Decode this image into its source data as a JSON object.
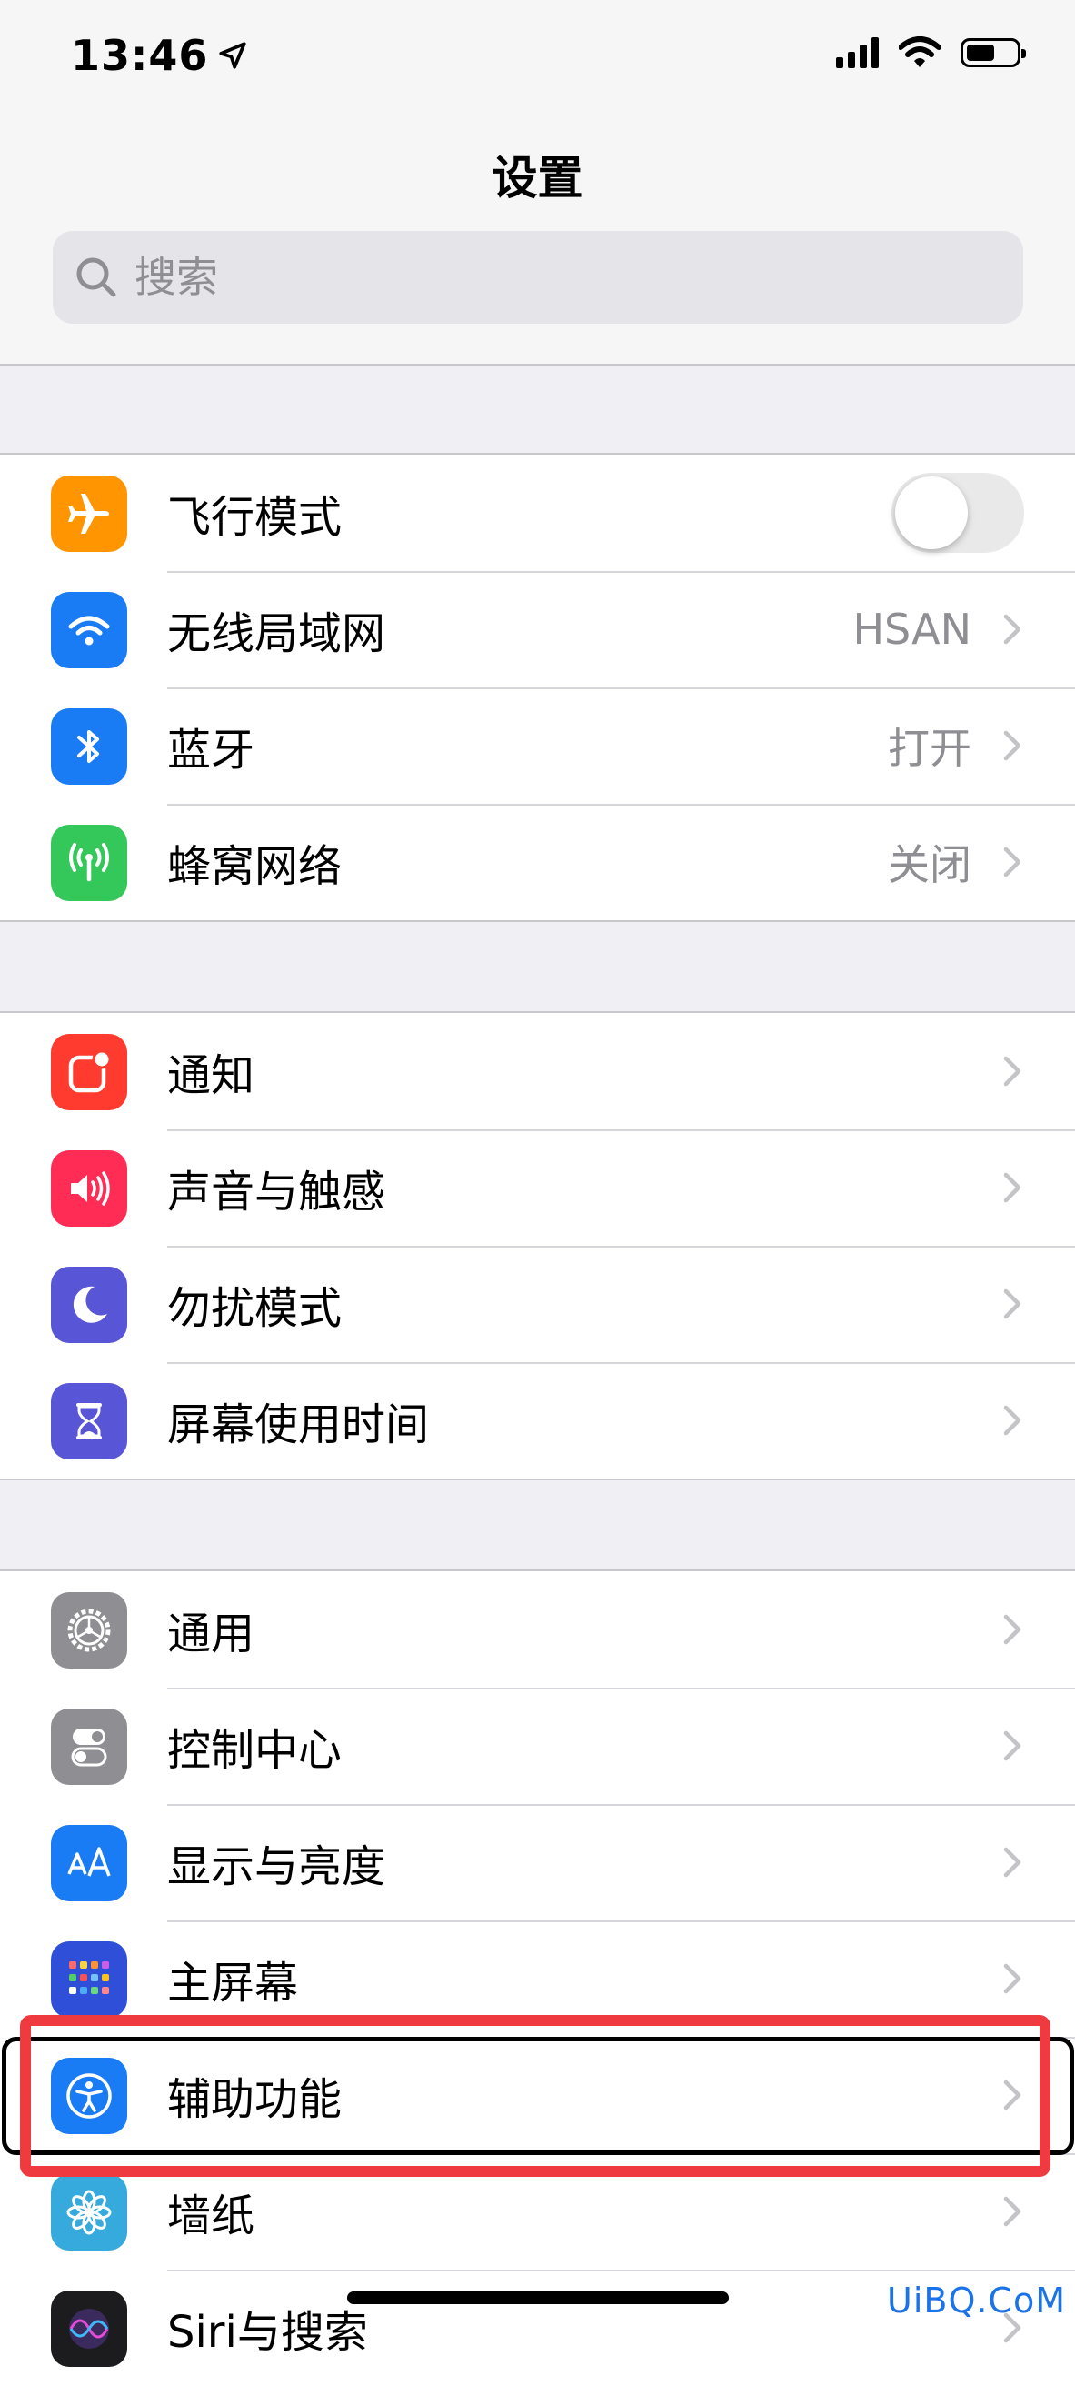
{
  "status_bar": {
    "time": "13:46"
  },
  "nav": {
    "title": "设置"
  },
  "search": {
    "placeholder": "搜索"
  },
  "groups": [
    {
      "rows": [
        {
          "label": "飞行模式",
          "icon": "airplane-icon",
          "color": "#ff9500",
          "toggle": false
        },
        {
          "label": "无线局域网",
          "value": "HSAN",
          "icon": "wifi-icon",
          "color": "#1a7cf5"
        },
        {
          "label": "蓝牙",
          "value": "打开",
          "icon": "bluetooth-icon",
          "color": "#1a7cf5"
        },
        {
          "label": "蜂窝网络",
          "value": "关闭",
          "icon": "cellular-antenna-icon",
          "color": "#34c759"
        }
      ]
    },
    {
      "rows": [
        {
          "label": "通知",
          "icon": "notifications-icon",
          "color": "#ff3b30"
        },
        {
          "label": "声音与触感",
          "icon": "speaker-icon",
          "color": "#ff2d55"
        },
        {
          "label": "勿扰模式",
          "icon": "moon-icon",
          "color": "#5856d6"
        },
        {
          "label": "屏幕使用时间",
          "icon": "hourglass-icon",
          "color": "#5856d6"
        }
      ]
    },
    {
      "rows": [
        {
          "label": "通用",
          "icon": "gear-icon",
          "color": "#8e8e93"
        },
        {
          "label": "控制中心",
          "icon": "switches-icon",
          "color": "#8e8e93"
        },
        {
          "label": "显示与亮度",
          "icon": "text-size-icon",
          "color": "#1a7cf5"
        },
        {
          "label": "主屏幕",
          "icon": "home-screen-grid-icon",
          "color": "#2f4fd8"
        },
        {
          "label": "辅助功能",
          "icon": "accessibility-icon",
          "color": "#1a7cf5",
          "highlighted": true
        },
        {
          "label": "墙纸",
          "icon": "flower-icon",
          "color": "#36aadc"
        },
        {
          "label": "Siri与搜索",
          "icon": "siri-icon",
          "color": "#1c1c1e"
        }
      ]
    }
  ],
  "watermark": "UiBQ.CoM"
}
